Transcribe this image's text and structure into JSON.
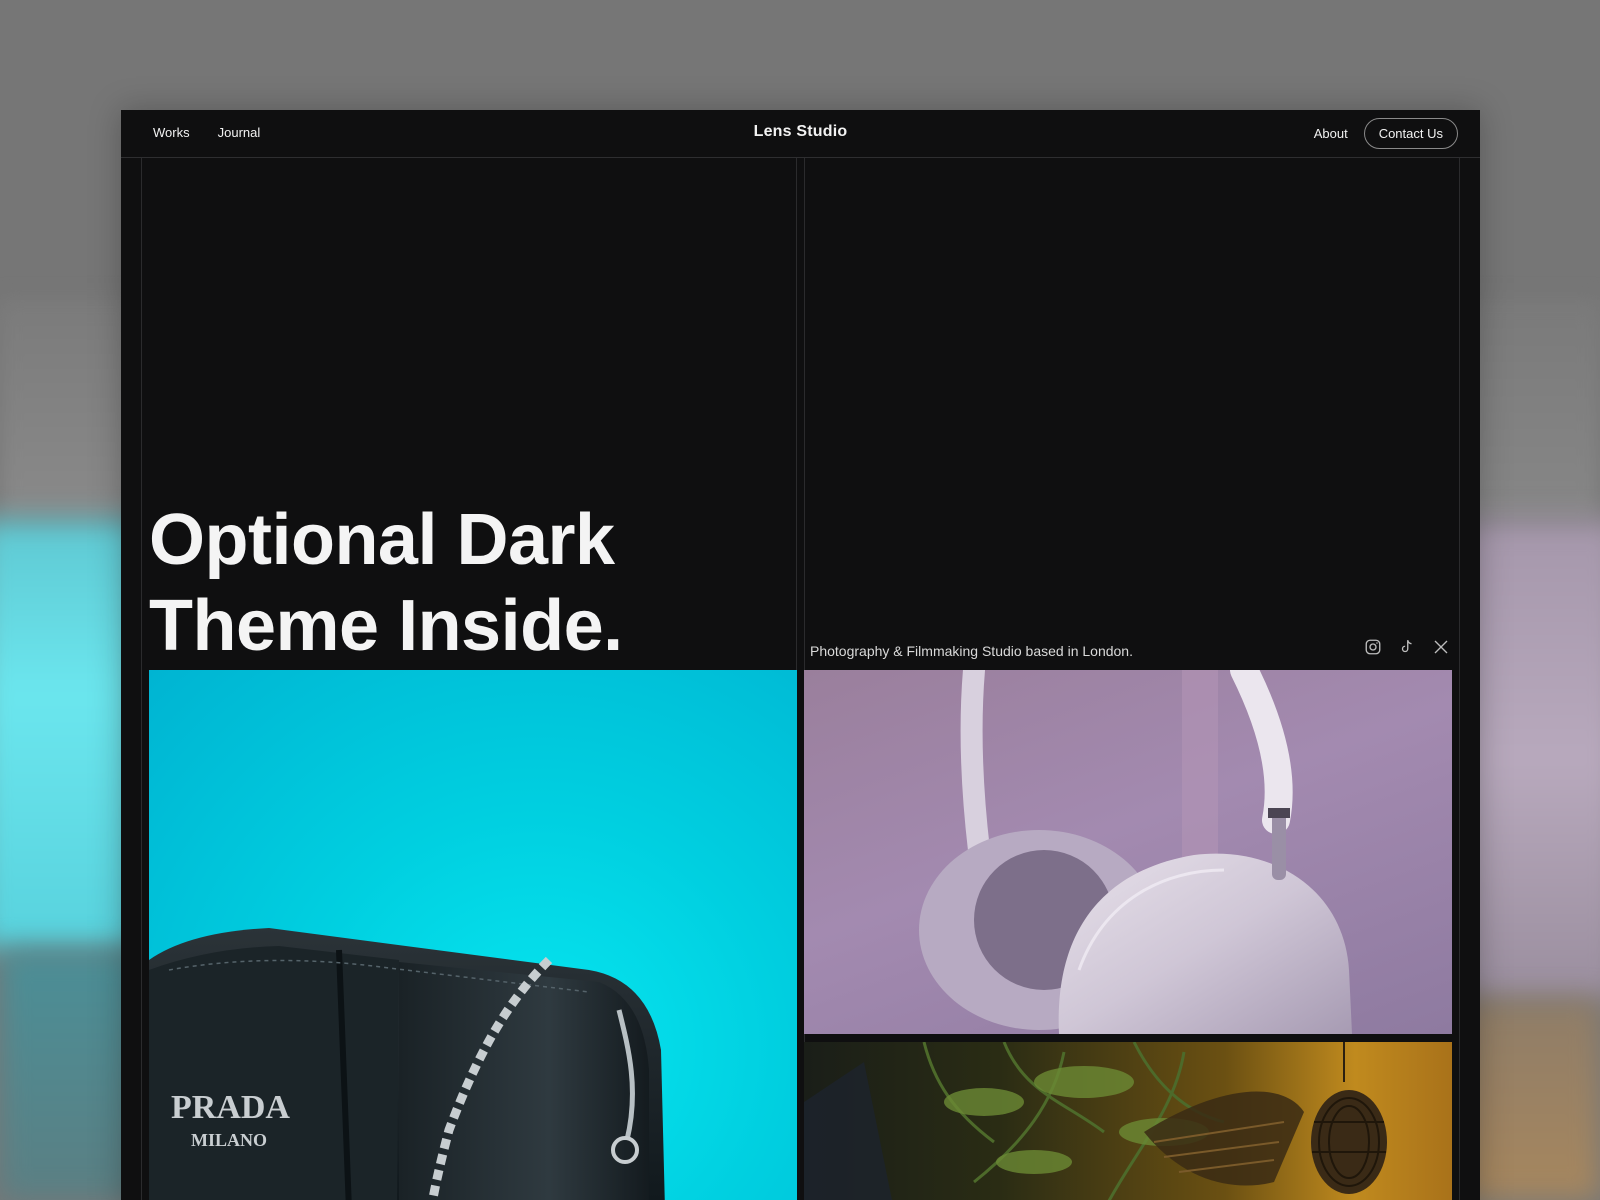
{
  "nav": {
    "left": [
      "Works",
      "Journal"
    ],
    "brand": "Lens Studio",
    "about": "About",
    "contact": "Contact Us"
  },
  "hero": {
    "line1": "Optional Dark",
    "line2": "Theme Inside.",
    "tagline": "Photography & Filmmaking Studio based in London."
  },
  "social": [
    "instagram-icon",
    "tiktok-icon",
    "x-icon"
  ],
  "images": {
    "bag_text1": "PRADA",
    "bag_text2": "MILANO"
  },
  "colors": {
    "background": "#0f0f10",
    "text": "#f4f4f4",
    "accent_cyan": "#00cfe0",
    "accent_lavender": "#a38ab0"
  }
}
